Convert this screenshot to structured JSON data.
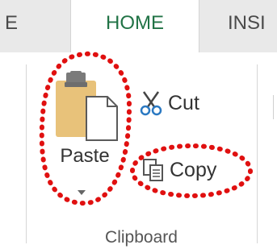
{
  "tabs": {
    "left_partial": "E",
    "home": "HOME",
    "insert_partial": "INSI"
  },
  "clipboard": {
    "paste_label": "Paste",
    "cut_label": "Cut",
    "copy_label": "Copy",
    "group_label": "Clipboard"
  },
  "colors": {
    "active_tab_text": "#217346",
    "annotation": "#e01010",
    "clipboard_board": "#e8c27a",
    "clipboard_clip": "#7a7a7a",
    "scissors": "#2b79c2"
  },
  "icons": {
    "paste": "clipboard-paste-icon",
    "cut": "scissors-icon",
    "copy": "copy-icon",
    "dropdown": "chevron-down-icon"
  }
}
